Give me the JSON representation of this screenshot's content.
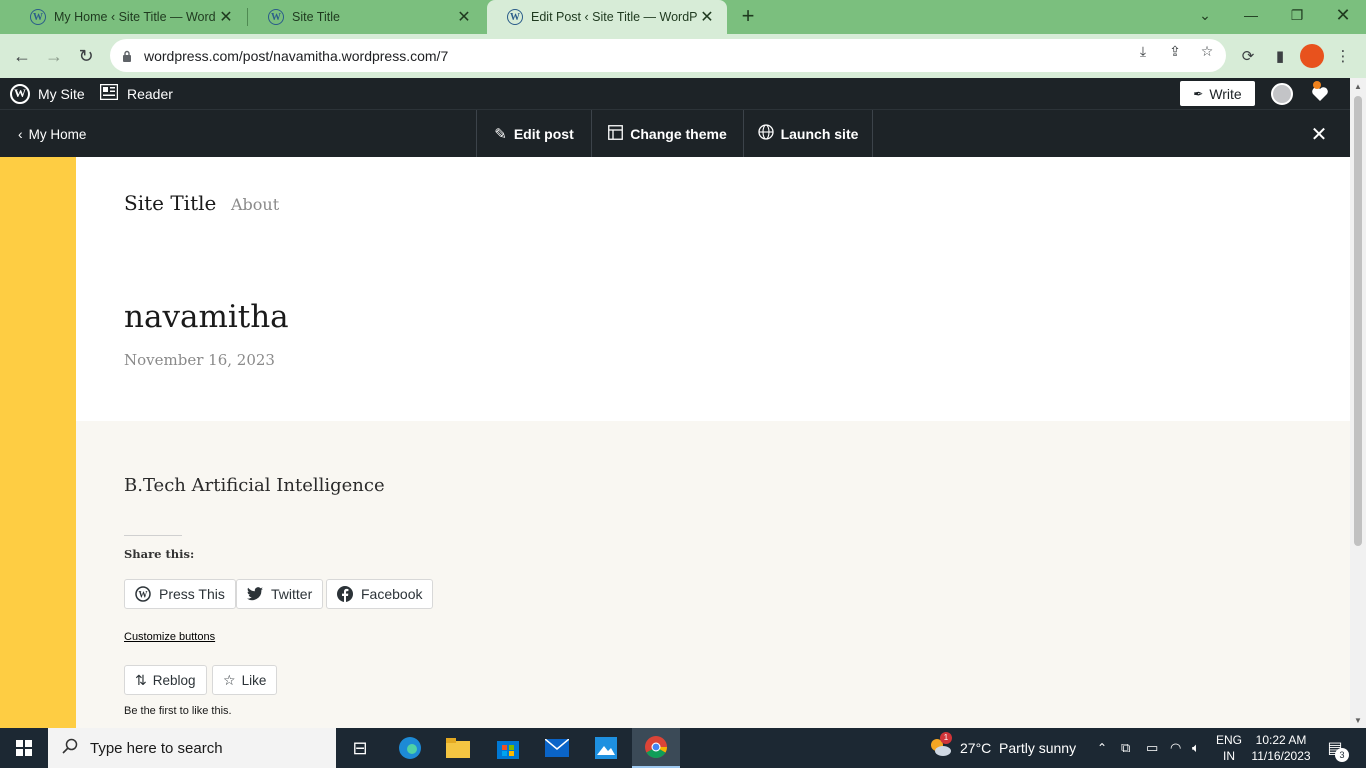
{
  "browser": {
    "tabs": [
      {
        "title": "My Home ‹ Site Title — WordPress.com",
        "active": false
      },
      {
        "title": "Site Title",
        "active": false
      },
      {
        "title": "Edit Post ‹ Site Title — WordPress.com",
        "active": true
      }
    ],
    "address": "wordpress.com/post/navamitha.wordpress.com/7"
  },
  "adminbar": {
    "my_site": "My Site",
    "reader": "Reader",
    "write": "Write"
  },
  "previewbar": {
    "back": "My Home",
    "edit_post": "Edit post",
    "change_theme": "Change theme",
    "launch_site": "Launch site"
  },
  "site": {
    "title": "Site Title",
    "nav_about": "About"
  },
  "post": {
    "title": "navamitha",
    "date": "November 16, 2023",
    "body": "B.Tech Artificial Intelligence"
  },
  "sharing": {
    "label": "Share this:",
    "buttons": [
      "Press This",
      "Twitter",
      "Facebook"
    ],
    "customize": "Customize buttons",
    "reblog": "Reblog",
    "like": "Like",
    "first_like": "Be the first to like this."
  },
  "taskbar": {
    "search_placeholder": "Type here to search",
    "weather": "27°C  Partly sunny",
    "weather_badge": "1",
    "lang_top": "ENG",
    "lang_bottom": "IN",
    "time": "10:22 AM",
    "date": "11/16/2023",
    "notifications": "3"
  },
  "colors": {
    "tabstrip": "#7bbf7e",
    "toolbar": "#d7ecd7",
    "wp_dark": "#1d2327",
    "accent_yellow": "#fecd43",
    "content_bg": "#f9f7f2",
    "taskbar": "#1c2833"
  }
}
